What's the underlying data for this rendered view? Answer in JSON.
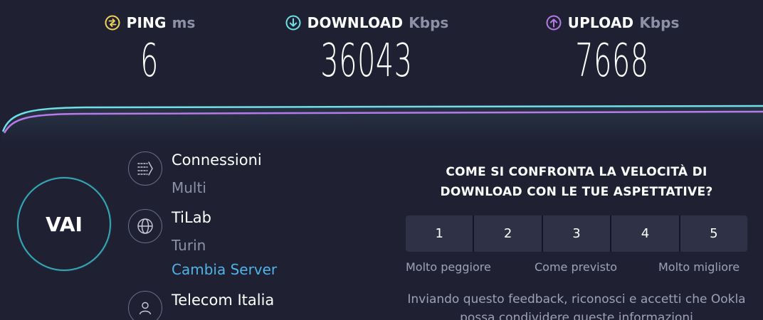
{
  "colors": {
    "background": "#1f2133",
    "ping_accent": "#f2d35b",
    "download_accent": "#6fe0e6",
    "upload_accent": "#b67be8",
    "link": "#4fb3e8",
    "muted_text": "#8e91a6"
  },
  "metrics": {
    "ping": {
      "icon": "ping-icon",
      "label": "PING",
      "unit": "ms",
      "value": "6"
    },
    "download": {
      "icon": "download-arrow-icon",
      "label": "DOWNLOAD",
      "unit": "Kbps",
      "value": "36043"
    },
    "upload": {
      "icon": "upload-arrow-icon",
      "label": "UPLOAD",
      "unit": "Kbps",
      "value": "7668"
    }
  },
  "go_button": {
    "label": "VAI"
  },
  "connection": {
    "icon": "connections-icon",
    "title": "Connessioni",
    "value": "Multi"
  },
  "server": {
    "icon": "globe-icon",
    "name": "TiLab",
    "location": "Turin",
    "change_link": "Cambia Server"
  },
  "provider": {
    "icon": "user-icon",
    "name": "Telecom Italia"
  },
  "survey": {
    "question": "COME SI CONFRONTA LA VELOCITÀ DI DOWNLOAD CON LE TUE ASPETTATIVE?",
    "ratings": [
      "1",
      "2",
      "3",
      "4",
      "5"
    ],
    "labels": {
      "low": "Molto peggiore",
      "mid": "Come previsto",
      "high": "Molto migliore"
    },
    "feedback_text": "Inviando questo feedback, riconosci e accetti che Ookla possa condividere queste informazioni"
  }
}
